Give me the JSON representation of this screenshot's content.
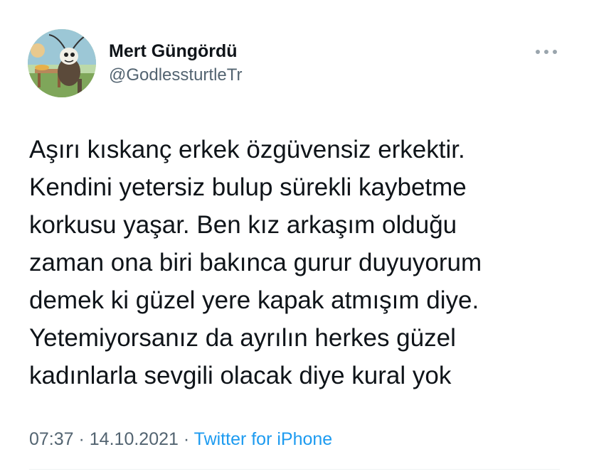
{
  "author": {
    "name": "Mert Güngördü",
    "handle": "@GodlessturtleTr",
    "avatar_icon": "cartoon-character-avatar"
  },
  "tweet": {
    "text": "Aşırı kıskanç erkek özgüvensiz erkektir.\nKendini yetersiz bulup sürekli kaybetme\nkorkusu yaşar. Ben kız arkaşım olduğu\nzaman ona biri bakınca gurur duyuyorum\ndemek ki güzel yere kapak atmışım diye.\nYetemiyorsanız da ayrılın herkes güzel\nkadınlarla sevgili olacak diye kural yok"
  },
  "meta": {
    "time": "07:37",
    "separator": " · ",
    "date": "14.10.2021",
    "source": "Twitter for iPhone"
  },
  "more_icon": "more-options-icon",
  "colors": {
    "text_primary": "#0f1419",
    "text_secondary": "#536471",
    "link": "#1d9bf0",
    "divider": "#eff3f4"
  }
}
